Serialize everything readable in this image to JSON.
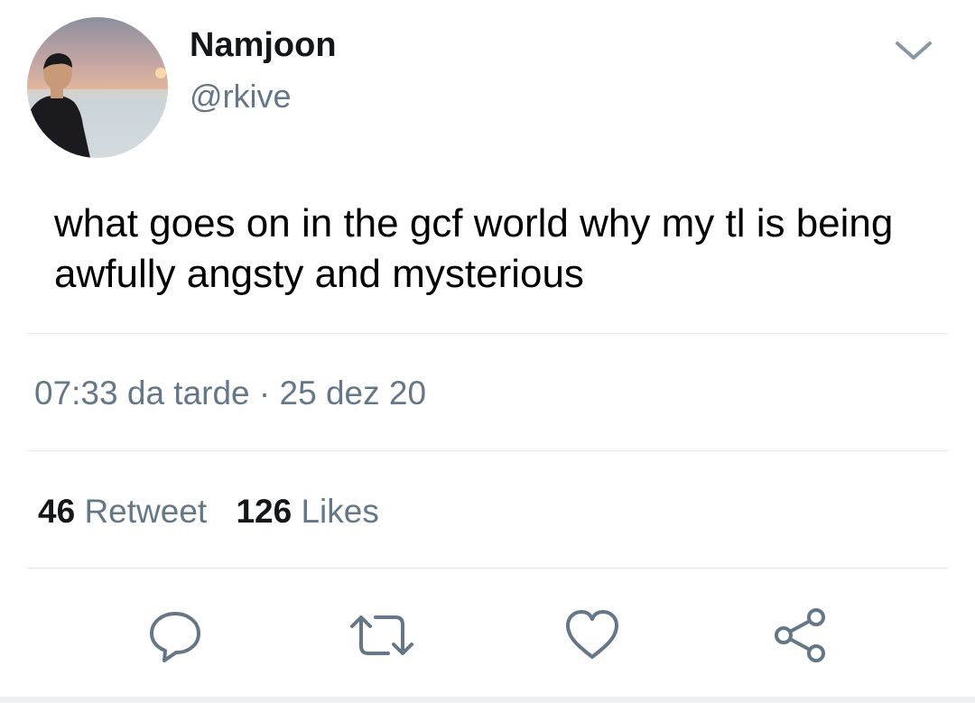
{
  "tweet": {
    "author": {
      "display_name": "Namjoon",
      "handle": "@rkive"
    },
    "text": "what goes on in the gcf world why my tl is being awfully angsty and mysterious",
    "timestamp": "07:33 da tarde · 25 dez 20",
    "stats": {
      "retweets_count": "46",
      "retweets_label": "Retweet",
      "likes_count": "126",
      "likes_label": "Likes"
    },
    "actions": [
      "reply-icon",
      "retweet-icon",
      "like-icon",
      "share-icon"
    ]
  },
  "colors": {
    "secondary_text": "#657786",
    "divider": "#e1e8ed",
    "icon": "#657786"
  }
}
